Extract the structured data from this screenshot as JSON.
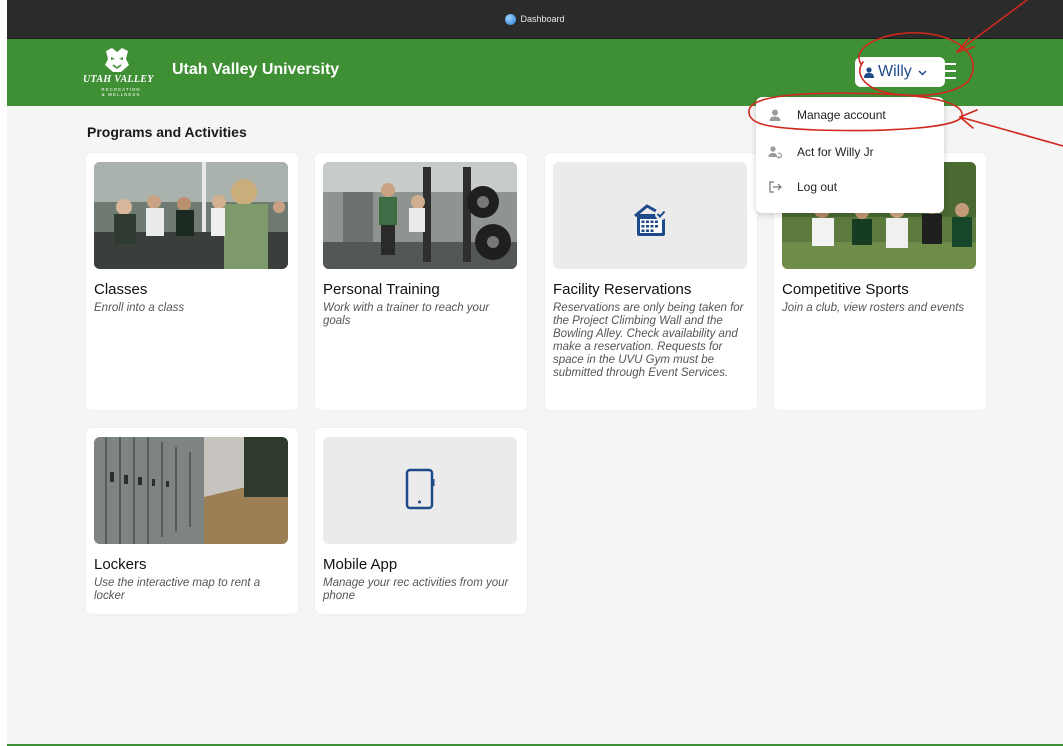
{
  "window": {
    "title": "Dashboard"
  },
  "header": {
    "logo_wordmark": "UTAH VALLEY",
    "logo_sub": "RECREATION & WELLNESS",
    "brand": "Utah Valley University",
    "user_name": "Willy"
  },
  "main": {
    "section_title": "Programs and Activities",
    "cards": [
      {
        "title": "Classes",
        "desc": "Enroll into a class"
      },
      {
        "title": "Personal Training",
        "desc": "Work with a trainer to reach your goals"
      },
      {
        "title": "Facility Reservations",
        "desc": "Reservations are only being taken for the Project Climbing Wall and the Bowling Alley. Check availability and make a reservation. Requests for space in the UVU Gym must be submitted through Event Services."
      },
      {
        "title": "Competitive Sports",
        "desc": "Join a club, view rosters and events"
      },
      {
        "title": "Lockers",
        "desc": "Use the interactive map to rent a locker"
      },
      {
        "title": "Mobile App",
        "desc": "Manage your rec activities from your phone"
      }
    ]
  },
  "user_menu": {
    "items": [
      {
        "label": "Manage account",
        "icon": "person-icon"
      },
      {
        "label": "Act for  Willy Jr",
        "icon": "proxy-user-icon"
      },
      {
        "label": "Log out",
        "icon": "logout-icon"
      }
    ]
  },
  "colors": {
    "header_green": "#3f8f34",
    "user_text_blue": "#1e4a8a",
    "annotation_red": "#d0281c"
  }
}
